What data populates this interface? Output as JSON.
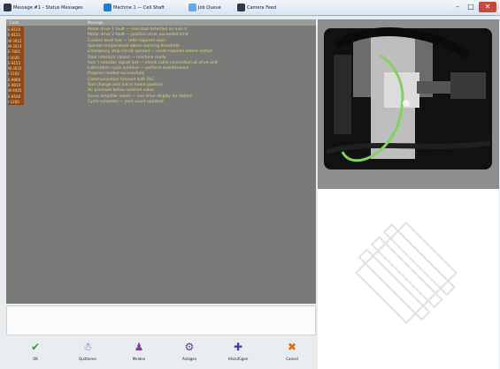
{
  "window": {
    "items": [
      {
        "label": "Message #1 – Status Messages",
        "icon": "app-icon"
      },
      {
        "label": "Machine 1 — Cell Shaft",
        "icon": "machine-icon"
      },
      {
        "label": "Job Queue",
        "icon": "queue-icon"
      },
      {
        "label": "Camera Feed",
        "icon": "camera-icon"
      }
    ],
    "controls": {
      "minimize": "–",
      "maximize": "□",
      "close": "✕"
    }
  },
  "log": {
    "columns": [
      "Code",
      "Message"
    ],
    "rows": [
      {
        "code": "E-8150",
        "msg": "Motor drive 1 fault — overload detected on axis X"
      },
      {
        "code": "E-8151",
        "msg": "Motor drive 2 fault — position error exceeded limit"
      },
      {
        "code": "W-3012",
        "msg": "Coolant level low — refill required soon"
      },
      {
        "code": "W-3014",
        "msg": "Spindle temperature above warning threshold"
      },
      {
        "code": "E-7001",
        "msg": "Emergency stop circuit opened — reset required before restart"
      },
      {
        "code": "I-1020",
        "msg": "Door interlock closed — machine ready"
      },
      {
        "code": "E-8155",
        "msg": "Axis Y encoder signal lost — check cable connection at drive unit"
      },
      {
        "code": "W-3020",
        "msg": "Lubrication cycle overdue — perform maintenance"
      },
      {
        "code": "I-1102",
        "msg": "Program loaded successfully"
      },
      {
        "code": "E-9000",
        "msg": "Communication timeout with PLC"
      },
      {
        "code": "E-9010",
        "msg": "Tool change arm not in home position"
      },
      {
        "code": "W-4005",
        "msg": "Air pressure below nominal value"
      },
      {
        "code": "E-8160",
        "msg": "Servo amplifier alarm — see drive display for details"
      },
      {
        "code": "I-1200",
        "msg": "Cycle complete — part count updated"
      }
    ]
  },
  "toolbar": {
    "buttons": [
      {
        "label": "OK",
        "icon": "checkmark-icon",
        "glyph": "✔",
        "color": "#2e9d3a"
      },
      {
        "label": "Quittieren",
        "icon": "acknowledge-icon",
        "glyph": "☃",
        "color": "#5a4fb0"
      },
      {
        "label": "Melden",
        "icon": "report-icon",
        "glyph": "♟",
        "color": "#7a3f9e"
      },
      {
        "label": "Anlagen",
        "icon": "plant-icon",
        "glyph": "⚙",
        "color": "#5b3e9a"
      },
      {
        "label": "Hinzufügen",
        "icon": "add-icon",
        "glyph": "✚",
        "color": "#3c3db0"
      },
      {
        "label": "Cancel",
        "icon": "cancel-icon",
        "glyph": "✖",
        "color": "#e06a1c"
      }
    ]
  }
}
